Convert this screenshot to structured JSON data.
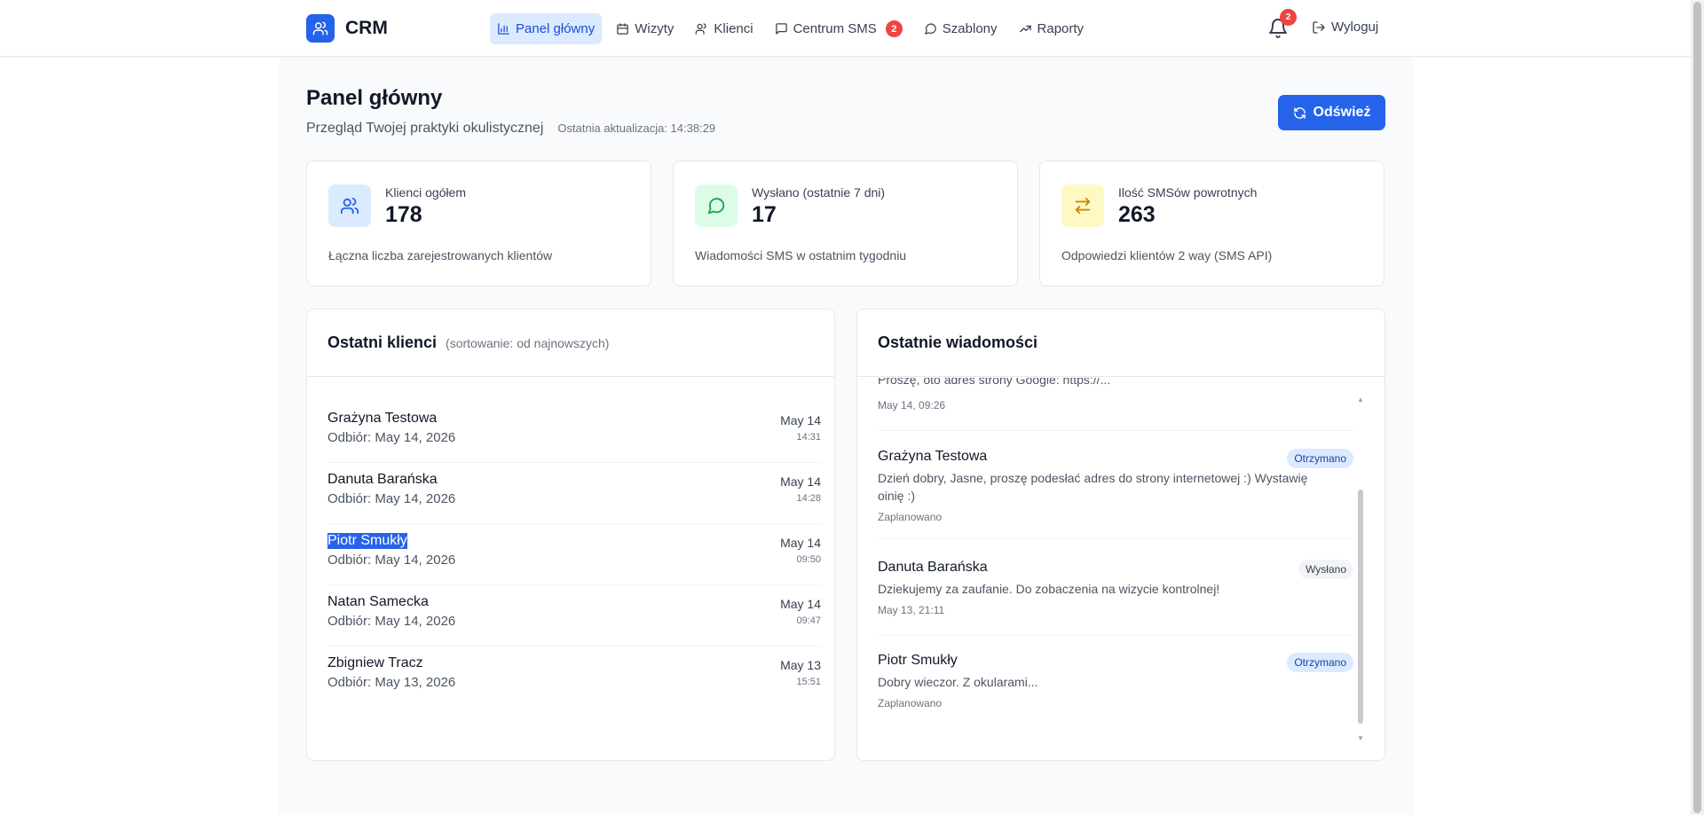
{
  "app": {
    "name": "CRM"
  },
  "nav": {
    "items": [
      {
        "label": "Panel główny",
        "icon": "bar-chart-icon",
        "active": true
      },
      {
        "label": "Wizyty",
        "icon": "calendar-icon"
      },
      {
        "label": "Klienci",
        "icon": "users-icon"
      },
      {
        "label": "Centrum SMS",
        "icon": "message-square-icon",
        "badge": "2"
      },
      {
        "label": "Szablony",
        "icon": "message-circle-icon"
      },
      {
        "label": "Raporty",
        "icon": "trending-up-icon"
      }
    ],
    "notifications_count": "2",
    "logout_label": "Wyloguj"
  },
  "page": {
    "title": "Panel główny",
    "subtitle": "Przegląd Twojej praktyki okulistycznej",
    "last_update": "Ostatnia aktualizacja: 14:38:29",
    "refresh_label": "Odśwież"
  },
  "stats": [
    {
      "label": "Klienci ogółem",
      "value": "178",
      "desc": "Łączna liczba zarejestrowanych klientów",
      "icon": "users-icon",
      "color": "#2563eb",
      "bg": "#dbeafe"
    },
    {
      "label": "Wysłano (ostatnie 7 dni)",
      "value": "17",
      "desc": "Wiadomości SMS w ostatnim tygodniu",
      "icon": "message-circle-icon",
      "color": "#16a34a",
      "bg": "#dcfce7"
    },
    {
      "label": "Ilość SMSów powrotnych",
      "value": "263",
      "desc": "Odpowiedzi klientów 2 way (SMS API)",
      "icon": "arrows-exchange-icon",
      "color": "#ca8a04",
      "bg": "#fef9c3"
    }
  ],
  "clients_panel": {
    "title": "Ostatni klienci",
    "hint": "(sortowanie: od najnowszych)",
    "rows": [
      {
        "name": "Grażyna Testowa",
        "sub": "Odbiór: May 14, 2026",
        "date": "May 14",
        "time": "14:31"
      },
      {
        "name": "Danuta Barańska",
        "sub": "Odbiór: May 14, 2026",
        "date": "May 14",
        "time": "14:28"
      },
      {
        "name": "Piotr Smukły",
        "sub": "Odbiór: May 14, 2026",
        "date": "May 14",
        "time": "09:50"
      },
      {
        "name": "Natan Samecka",
        "sub": "Odbiór: May 14, 2026",
        "date": "May 14",
        "time": "09:47"
      },
      {
        "name": "Zbigniew Tracz",
        "sub": "Odbiór: May 13, 2026",
        "date": "May 13",
        "time": "15:51"
      }
    ]
  },
  "messages_panel": {
    "title": "Ostatnie wiadomości",
    "partial": {
      "text": "Proszę, oto adres strony Google: https://...",
      "meta": "May 14, 09:26"
    },
    "items": [
      {
        "name": "Grażyna Testowa",
        "badge": "Otrzymano",
        "text": "Dzień dobry, Jasne, proszę podesłać adres do strony internetowej :) Wystawię oinię :)",
        "meta": "Zaplanowano"
      },
      {
        "name": "Danuta Barańska",
        "badge": "Wysłano",
        "text": "Dziekujemy za zaufanie. Do zobaczenia na wizycie kontrolnej!",
        "meta": "May 13, 21:11"
      },
      {
        "name": "Piotr Smukły",
        "badge": "Otrzymano",
        "text": "Dobry wieczor. Z okularami...",
        "meta": "Zaplanowano"
      }
    ]
  }
}
